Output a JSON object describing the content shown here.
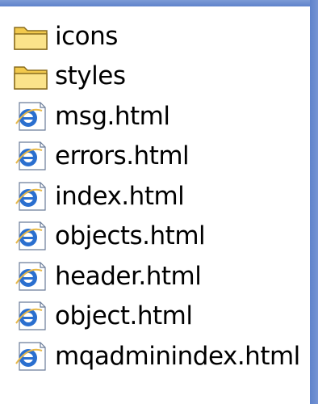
{
  "colors": {
    "frame": "#6d8fd0",
    "folder": "#f5d76e",
    "ie_blue": "#2a6fcf"
  },
  "files": [
    {
      "name": "icons",
      "icon": "folder-icon"
    },
    {
      "name": "styles",
      "icon": "folder-icon"
    },
    {
      "name": "msg.html",
      "icon": "html-document-icon"
    },
    {
      "name": "errors.html",
      "icon": "html-document-icon"
    },
    {
      "name": "index.html",
      "icon": "html-document-icon"
    },
    {
      "name": "objects.html",
      "icon": "html-document-icon"
    },
    {
      "name": "header.html",
      "icon": "html-document-icon"
    },
    {
      "name": "object.html",
      "icon": "html-document-icon"
    },
    {
      "name": "mqadminindex.html",
      "icon": "html-document-icon"
    }
  ]
}
